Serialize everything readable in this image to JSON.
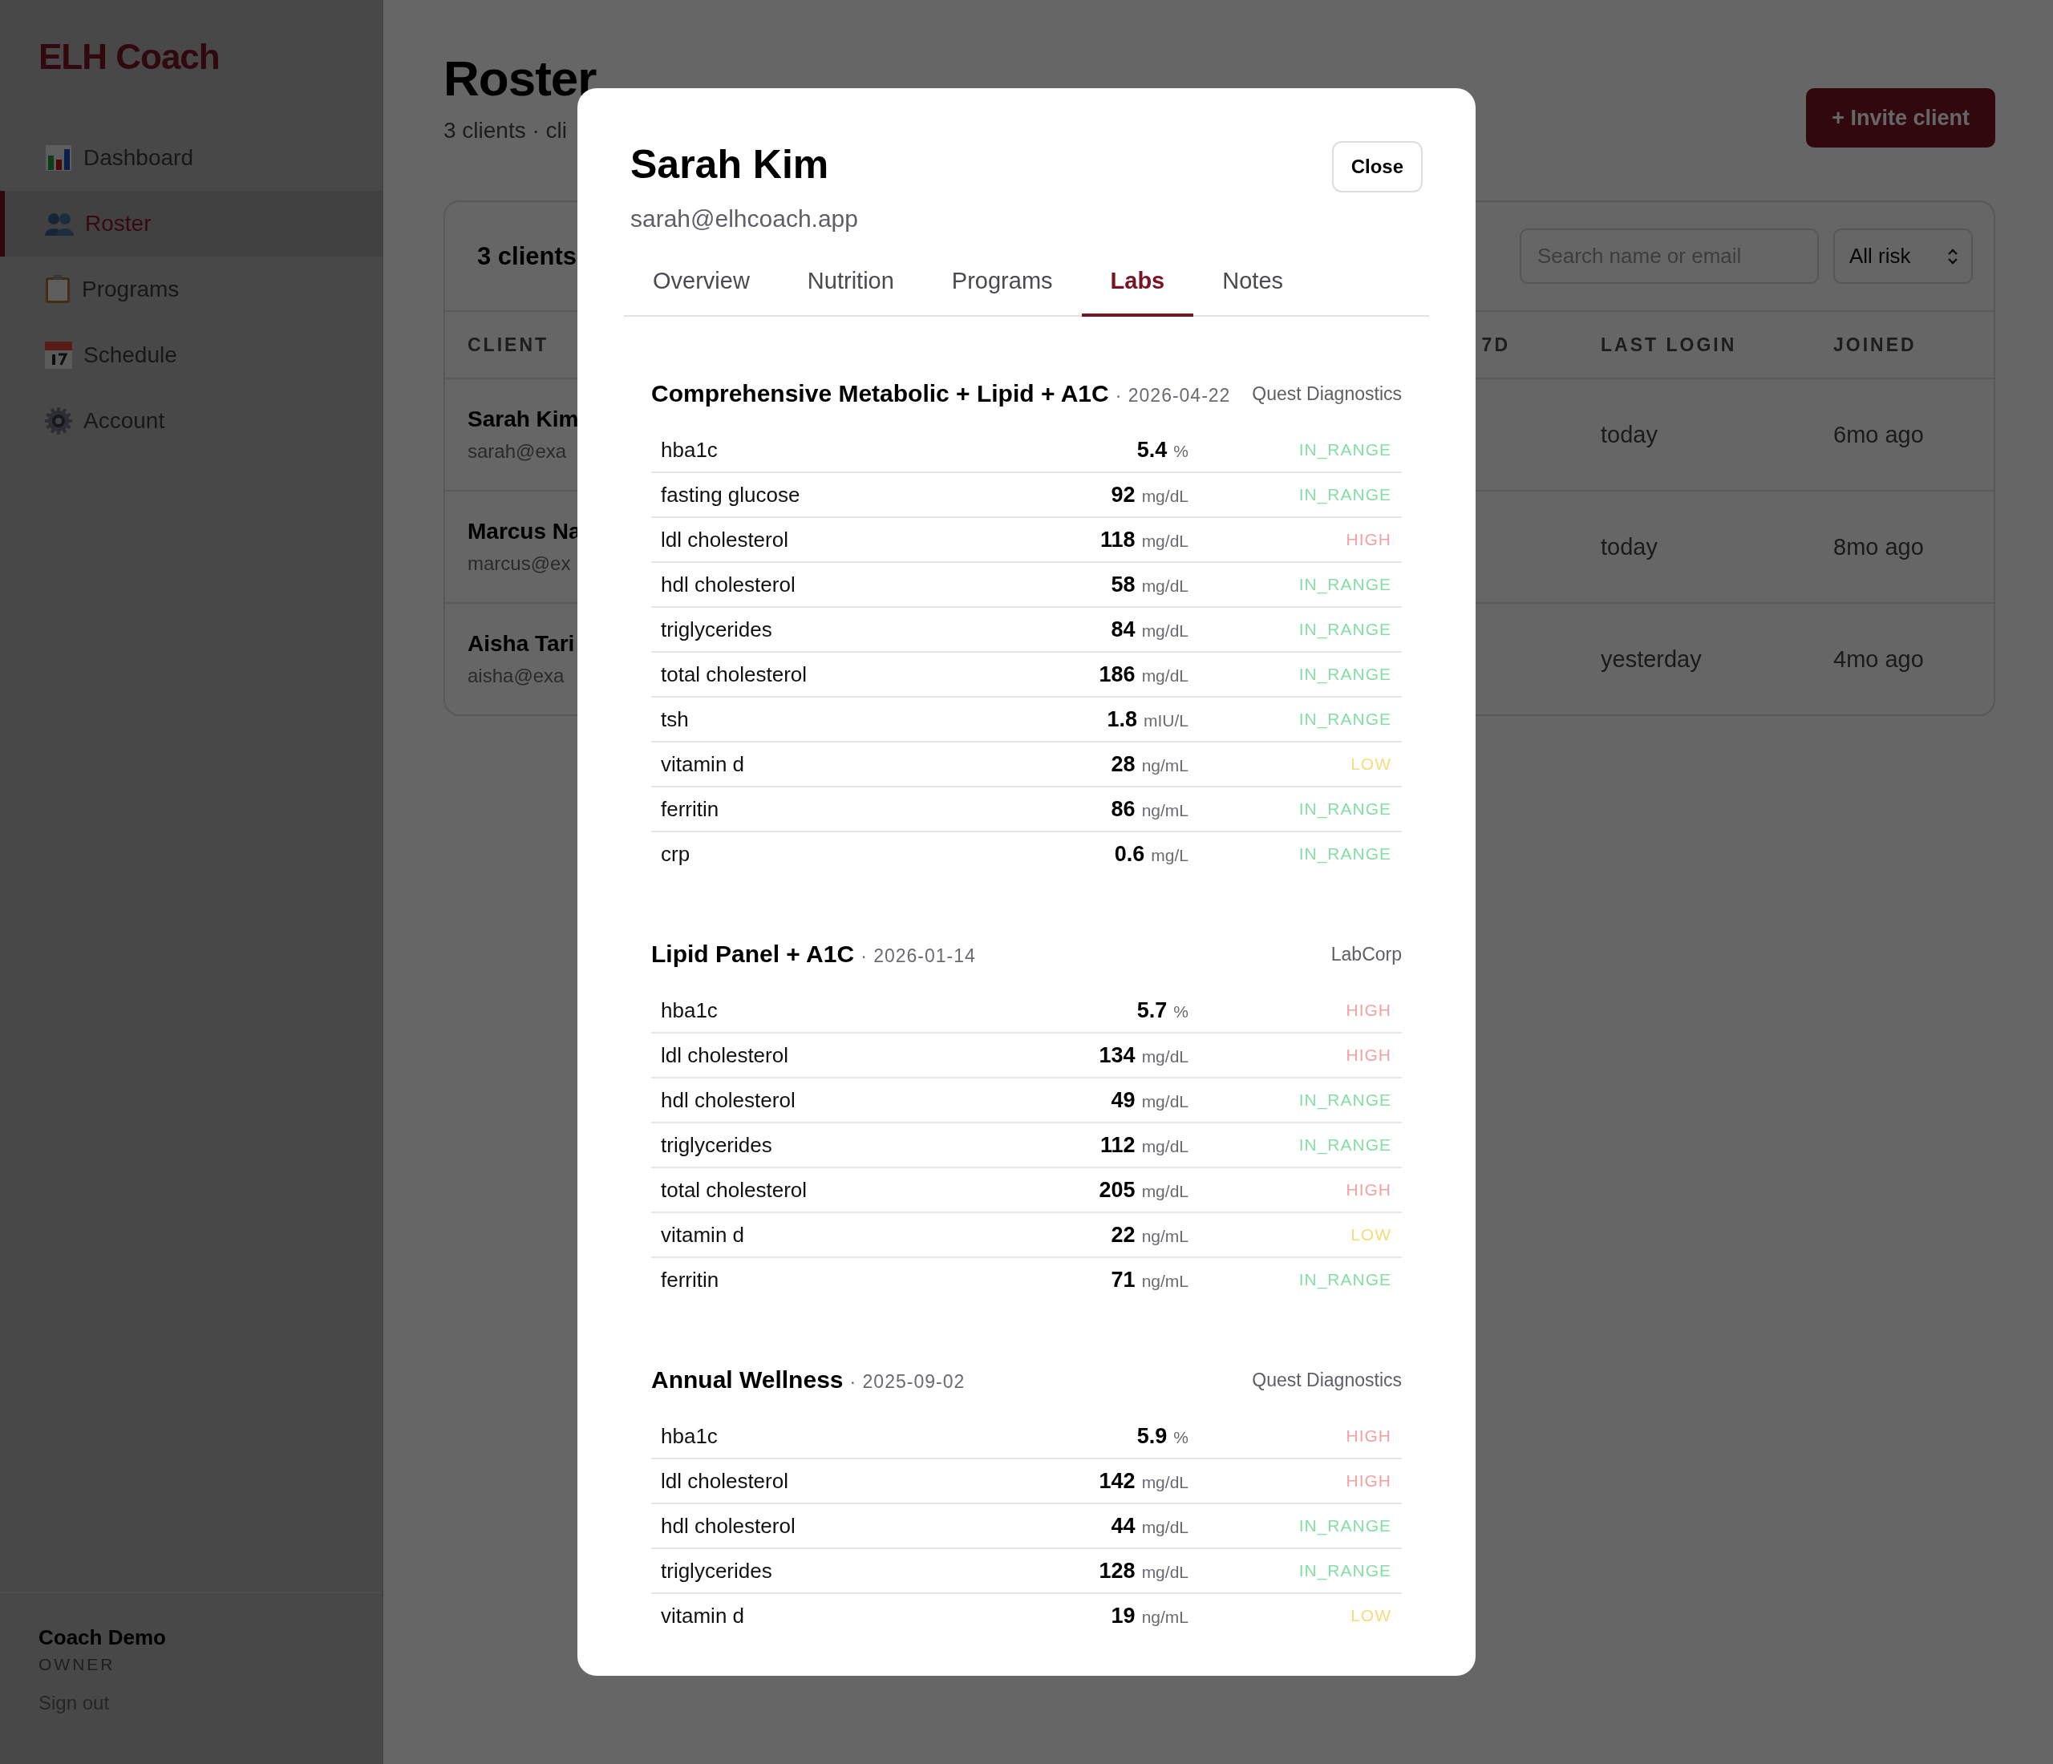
{
  "sidebar": {
    "brand": "ELH Coach",
    "items": [
      {
        "label": "Dashboard",
        "selected": false
      },
      {
        "label": "Roster",
        "selected": true
      },
      {
        "label": "Programs",
        "selected": false
      },
      {
        "label": "Schedule",
        "selected": false
      },
      {
        "label": "Account",
        "selected": false
      }
    ],
    "user": {
      "name": "Coach Demo",
      "role": "OWNER"
    },
    "sign_out": "Sign out"
  },
  "page": {
    "title": "Roster",
    "subtitle": "3 clients · cli",
    "invite_button": "+ Invite client"
  },
  "roster_card": {
    "count": "3 clients",
    "search": {
      "placeholder": "Search name or email"
    },
    "risk_filter": "All risk",
    "columns": [
      "CLIENT",
      "7D",
      "LAST LOGIN",
      "JOINED"
    ],
    "rows": [
      {
        "name": "Sarah Kim",
        "email": "sarah@exa",
        "last_login": "today",
        "joined": "6mo ago"
      },
      {
        "name": "Marcus Na",
        "email": "marcus@ex",
        "last_login": "today",
        "joined": "8mo ago"
      },
      {
        "name": "Aisha Tari",
        "email": "aisha@exa",
        "last_login": "yesterday",
        "joined": "4mo ago"
      }
    ]
  },
  "modal": {
    "name": "Sarah Kim",
    "email": "sarah@elhcoach.app",
    "close_button": "Close",
    "tabs": [
      {
        "label": "Overview",
        "selected": false
      },
      {
        "label": "Nutrition",
        "selected": false
      },
      {
        "label": "Programs",
        "selected": false
      },
      {
        "label": "Labs",
        "selected": true
      },
      {
        "label": "Notes",
        "selected": false
      }
    ],
    "lab_panels": [
      {
        "title": "Comprehensive Metabolic + Lipid + A1C",
        "date": "· 2026-04-22",
        "source": "Quest Diagnostics",
        "results": [
          {
            "name": "hba1c",
            "value": "5.4",
            "unit": "%",
            "status": "IN_RANGE",
            "kind": "in_range"
          },
          {
            "name": "fasting glucose",
            "value": "92",
            "unit": "mg/dL",
            "status": "IN_RANGE",
            "kind": "in_range"
          },
          {
            "name": "ldl cholesterol",
            "value": "118",
            "unit": "mg/dL",
            "status": "HIGH",
            "kind": "high"
          },
          {
            "name": "hdl cholesterol",
            "value": "58",
            "unit": "mg/dL",
            "status": "IN_RANGE",
            "kind": "in_range"
          },
          {
            "name": "triglycerides",
            "value": "84",
            "unit": "mg/dL",
            "status": "IN_RANGE",
            "kind": "in_range"
          },
          {
            "name": "total cholesterol",
            "value": "186",
            "unit": "mg/dL",
            "status": "IN_RANGE",
            "kind": "in_range"
          },
          {
            "name": "tsh",
            "value": "1.8",
            "unit": "mIU/L",
            "status": "IN_RANGE",
            "kind": "in_range"
          },
          {
            "name": "vitamin d",
            "value": "28",
            "unit": "ng/mL",
            "status": "LOW",
            "kind": "low"
          },
          {
            "name": "ferritin",
            "value": "86",
            "unit": "ng/mL",
            "status": "IN_RANGE",
            "kind": "in_range"
          },
          {
            "name": "crp",
            "value": "0.6",
            "unit": "mg/L",
            "status": "IN_RANGE",
            "kind": "in_range"
          }
        ]
      },
      {
        "title": "Lipid Panel + A1C",
        "date": "· 2026-01-14",
        "source": "LabCorp",
        "results": [
          {
            "name": "hba1c",
            "value": "5.7",
            "unit": "%",
            "status": "HIGH",
            "kind": "high"
          },
          {
            "name": "ldl cholesterol",
            "value": "134",
            "unit": "mg/dL",
            "status": "HIGH",
            "kind": "high"
          },
          {
            "name": "hdl cholesterol",
            "value": "49",
            "unit": "mg/dL",
            "status": "IN_RANGE",
            "kind": "in_range"
          },
          {
            "name": "triglycerides",
            "value": "112",
            "unit": "mg/dL",
            "status": "IN_RANGE",
            "kind": "in_range"
          },
          {
            "name": "total cholesterol",
            "value": "205",
            "unit": "mg/dL",
            "status": "HIGH",
            "kind": "high"
          },
          {
            "name": "vitamin d",
            "value": "22",
            "unit": "ng/mL",
            "status": "LOW",
            "kind": "low"
          },
          {
            "name": "ferritin",
            "value": "71",
            "unit": "ng/mL",
            "status": "IN_RANGE",
            "kind": "in_range"
          }
        ]
      },
      {
        "title": "Annual Wellness",
        "date": "· 2025-09-02",
        "source": "Quest Diagnostics",
        "results": [
          {
            "name": "hba1c",
            "value": "5.9",
            "unit": "%",
            "status": "HIGH",
            "kind": "high"
          },
          {
            "name": "ldl cholesterol",
            "value": "142",
            "unit": "mg/dL",
            "status": "HIGH",
            "kind": "high"
          },
          {
            "name": "hdl cholesterol",
            "value": "44",
            "unit": "mg/dL",
            "status": "IN_RANGE",
            "kind": "in_range"
          },
          {
            "name": "triglycerides",
            "value": "128",
            "unit": "mg/dL",
            "status": "IN_RANGE",
            "kind": "in_range"
          },
          {
            "name": "vitamin d",
            "value": "19",
            "unit": "ng/mL",
            "status": "LOW",
            "kind": "low"
          }
        ]
      }
    ]
  }
}
